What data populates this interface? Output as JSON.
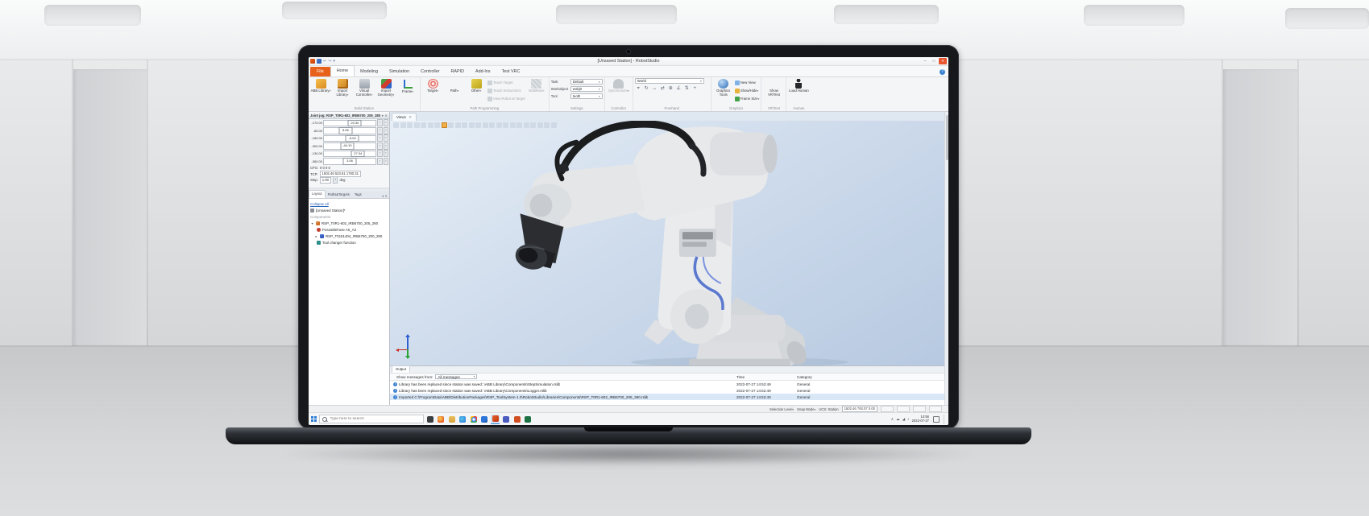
{
  "colors": {
    "accent_orange": "#E8611A",
    "close_red": "#E8552E",
    "viewport_blue": "#C6D6EA",
    "selection_blue": "#CFE3F5"
  },
  "titlebar": {
    "title": "[Unsaved Station] - RobotStudio",
    "min": "─",
    "max": "□",
    "close": "✕"
  },
  "tabs": {
    "file": "File",
    "items": [
      "Home",
      "Modeling",
      "Simulation",
      "Controller",
      "RAPID",
      "Add-Ins",
      "Test VRC"
    ],
    "active": "Home"
  },
  "ribbon": {
    "build_station": {
      "label": "Build Station",
      "buttons": [
        "ABB Library",
        "Import Library",
        "Virtual Controller",
        "Import Geometry",
        "Frame"
      ]
    },
    "path_programming": {
      "label": "Path Programming",
      "big_buttons": [
        "Target",
        "Path",
        "Other"
      ],
      "small_buttons": [
        "Teach Target",
        "Teach Instructions",
        "View Robot at Target"
      ],
      "multimove": "MultiMove"
    },
    "settings": {
      "label": "Settings",
      "fields": [
        {
          "label": "Task",
          "value": "Default"
        },
        {
          "label": "Workobject",
          "value": "wobj0"
        },
        {
          "label": "Tool",
          "value": "tool0"
        }
      ]
    },
    "controller": {
      "label": "Controller",
      "button": "Synchronize"
    },
    "freehand": {
      "label": "Freehand",
      "reference": "World"
    },
    "graphics": {
      "label": "Graphics",
      "big_button": "Graphics Tools",
      "small_buttons": [
        "New View",
        "Show/Hide",
        "Frame Size"
      ]
    },
    "vr": {
      "label": "VR/Test",
      "button": "Show VR/Test"
    },
    "human": {
      "label": "Human",
      "button": "Load Human"
    }
  },
  "jog_panel": {
    "title": "Joint jog: RSP_T0R1-602_IRB6700_205_280",
    "joints": [
      {
        "min": "-170.00",
        "value": "20.30"
      },
      {
        "min": "-65.00",
        "value": "5.06"
      },
      {
        "min": "-180.00",
        "value": "-5.00"
      },
      {
        "min": "-300.00",
        "value": "-44.10"
      },
      {
        "min": "-130.00",
        "value": "27.34"
      },
      {
        "min": "-360.00",
        "value": "3.06"
      }
    ],
    "cfg_label": "CFG:",
    "cfg_value": "0 0 0 0",
    "tcp_label": "TCP:",
    "tcp_value": "1502.46 533.61 1760.31",
    "step_label": "Step:",
    "step_value": "1.00",
    "step_unit": "deg"
  },
  "explorer": {
    "tabs": [
      "Layout",
      "Paths&Targets",
      "Tags"
    ],
    "active_tab": "Layout",
    "collapse_all": "Collapse all",
    "station": "[Unsaved Station]*",
    "components_header": "Components",
    "robot_node": "RSP_T0R1-602_IRB6700_205_280",
    "children": [
      "Poseablehose A6_A3",
      "RSP_T0151404_IRB6700_200_280",
      "Tool changer function"
    ]
  },
  "viewport": {
    "doc_tab": "View1",
    "close_glyph": "✕"
  },
  "output": {
    "tab": "Output",
    "filter_label": "Show messages from:",
    "filter_value": "All messages",
    "col_time": "Time",
    "col_category": "Category",
    "rows": [
      {
        "message": "Library has been replaced since station was saved: \\ABB Library\\Components\\StepSimulation.rslib",
        "time": "2022-07-27 14:52:49",
        "category": "General"
      },
      {
        "message": "Library has been replaced since station was saved: \\ABB Library\\Components\\Logger.rslib",
        "time": "2022-07-27 14:52:49",
        "category": "General"
      },
      {
        "message": "Imported C:\\ProgramData\\ABB\\DistributionPackages\\RSP_ToolSystem-1.0\\RobotStudio\\Libraries\\Components\\RSP_T0R1-602_IRB6700_205_280.rslib",
        "time": "2022-07-27 14:52:49",
        "category": "General"
      }
    ]
  },
  "statusbar": {
    "selection_level": "Selection Level",
    "snap_mode": "Snap Mode",
    "ucs": "UCS: Station",
    "coords": "1502.46 793.07 0.00"
  },
  "taskbar": {
    "search_placeholder": "Type here to search",
    "icons": [
      "task-view",
      "firefox",
      "folder",
      "edge",
      "chrome",
      "outlook",
      "robotstudio",
      "teams",
      "powerpoint",
      "excel"
    ],
    "active_icon": "robotstudio",
    "tray_time": "14:56",
    "tray_date": "2022-07-27"
  }
}
